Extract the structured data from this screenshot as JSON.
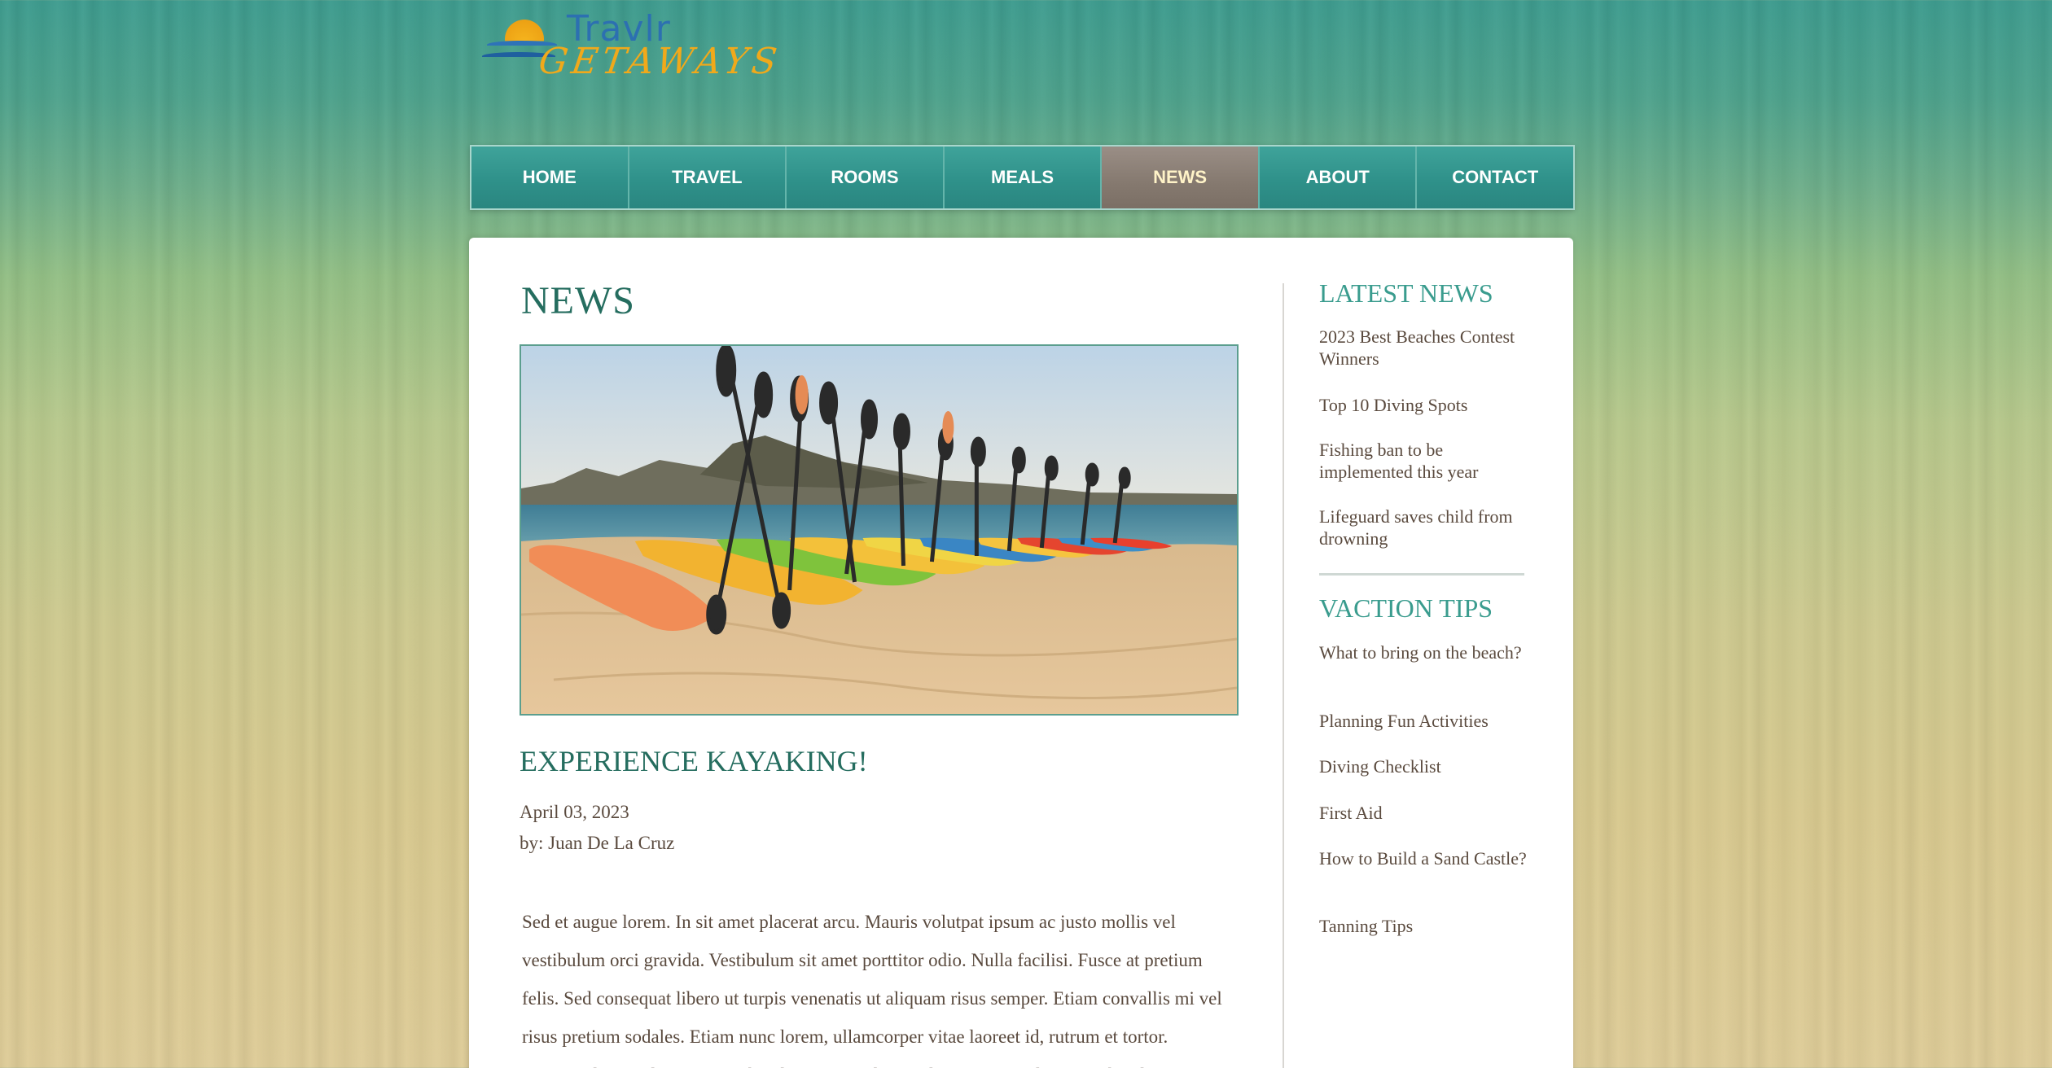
{
  "logo": {
    "name": "Travlr",
    "sub": "GETAWAYS"
  },
  "nav": [
    {
      "label": "HOME"
    },
    {
      "label": "TRAVEL"
    },
    {
      "label": "ROOMS"
    },
    {
      "label": "MEALS"
    },
    {
      "label": "NEWS",
      "active": true
    },
    {
      "label": "ABOUT"
    },
    {
      "label": "CONTACT"
    }
  ],
  "main": {
    "title": "NEWS",
    "article": {
      "title": "EXPERIENCE KAYAKING!",
      "date": "April 03, 2023",
      "author": "by: Juan De La Cruz",
      "body": "Sed et augue lorem. In sit amet placerat arcu. Mauris volutpat ipsum ac justo mollis vel vestibulum orci gravida. Vestibulum sit amet porttitor odio. Nulla facilisi. Fusce at pretium felis. Sed consequat libero ut turpis venenatis ut aliquam risus semper. Etiam convallis mi vel risus pretium sodales. Etiam nunc lorem, ullamcorper vitae laoreet id, rutrum et tortor. Vivamus luctus elementum vehicula. Aenean ultricies lacus sit amet lacinia vehicula."
    }
  },
  "sidebar": {
    "latest_heading": "LATEST NEWS",
    "latest": [
      "2023 Best Beaches Contest Winners",
      "Top 10 Diving Spots",
      "Fishing ban to be implemented this year",
      "Lifeguard saves child from drowning"
    ],
    "tips_heading": "VACTION TIPS",
    "tips": [
      "What to bring on the beach?",
      "Planning Fun Activities",
      "Diving Checklist",
      "First Aid",
      "How to Build a Sand Castle?",
      "Tanning Tips"
    ]
  },
  "colors": {
    "teal": "#2f918a",
    "active_nav": "#85796f",
    "heading": "#256d5f",
    "text": "#5a4a3e",
    "logo_blue": "#2c70b1",
    "logo_orange": "#f0a91b"
  }
}
